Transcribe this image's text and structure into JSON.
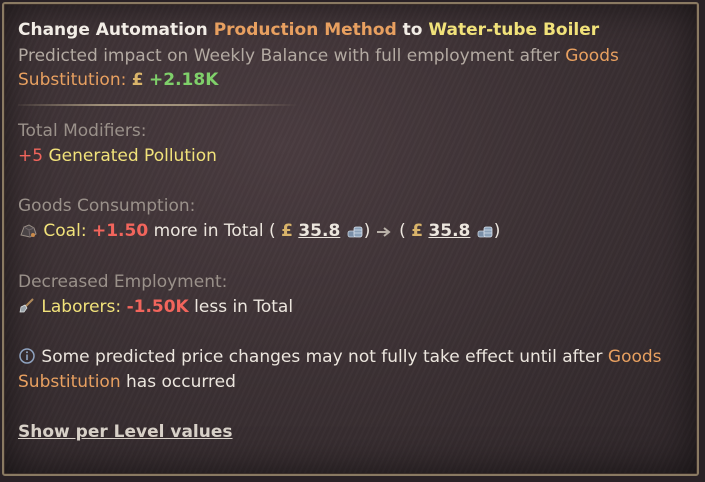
{
  "header": {
    "prefix": "Change Automation",
    "method_label": "Production Method",
    "connector": "to",
    "target": "Water-tube Boiler"
  },
  "impact": {
    "text1": "Predicted impact on Weekly Balance with full employment after",
    "goods": "Goods",
    "substitution": "Substitution",
    "colon": ":",
    "currency": "£",
    "value": "+2.18K"
  },
  "modifiers": {
    "heading": "Total Modifiers:",
    "value": "+5",
    "label": "Generated Pollution"
  },
  "consumption": {
    "heading": "Goods Consumption:",
    "good": "Coal",
    "colon": ":",
    "amount": "+1.50",
    "suffix": "more in Total (",
    "currency": "£",
    "price_before": "35.8",
    "close1": ")",
    "open2": "(",
    "price_after": "35.8",
    "close2": ")"
  },
  "employment": {
    "heading": "Decreased Employment:",
    "pop": "Laborers",
    "colon": ":",
    "amount": "-1.50K",
    "suffix": "less in Total"
  },
  "note": {
    "text1": "Some predicted price changes may not fully take effect until after",
    "goods": "Goods",
    "substitution": "Substitution",
    "text2": "has occurred"
  },
  "footer": {
    "link": "Show per Level values"
  },
  "colors": {
    "orange": "#e8a060",
    "yellow": "#f1e27a",
    "green": "#7fd06a",
    "red": "#f2655c",
    "border": "#8a7a62"
  }
}
